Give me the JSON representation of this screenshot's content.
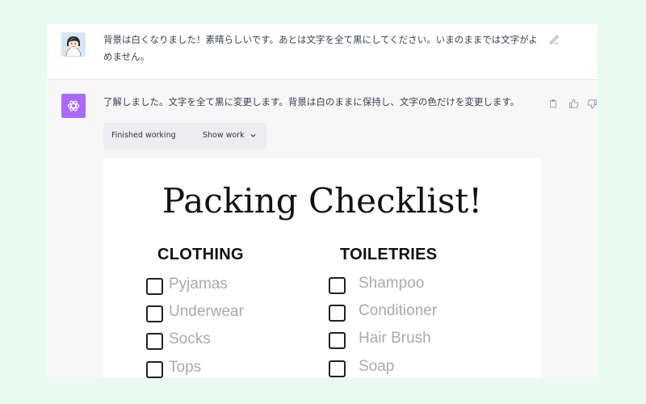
{
  "user_message": {
    "text": "背景は白くなりました！素晴らしいです。あとは文字を全て黒にしてください。いまのままでは文字がよめません。"
  },
  "assistant_message": {
    "text": "了解しました。文字を全て黒に変更します。背景は白のままに保持し、文字の色だけを変更します。",
    "work_status": "Finished working",
    "show_work_label": "Show work"
  },
  "checklist_image": {
    "title": "Packing Checklist!",
    "columns": [
      {
        "heading": "CLOTHING",
        "items": [
          "Pyjamas",
          "Underwear",
          "Socks",
          "Tops"
        ]
      },
      {
        "heading": "TOILETRIES",
        "items": [
          "Shampoo",
          "Conditioner",
          "Hair Brush",
          "Soap"
        ]
      }
    ]
  },
  "icons": {
    "edit": "edit-icon",
    "copy": "clipboard-icon",
    "thumbs_up": "thumbs-up-icon",
    "thumbs_down": "thumbs-down-icon",
    "chevron": "chevron-down-icon",
    "assistant_logo": "openai-logo-icon"
  },
  "colors": {
    "page_background": "#e9fbf1",
    "assistant_avatar": "#ab68ff",
    "assistant_row": "#f7f7f8",
    "work_box": "#ececf1",
    "item_text": "#aaaaaa"
  }
}
